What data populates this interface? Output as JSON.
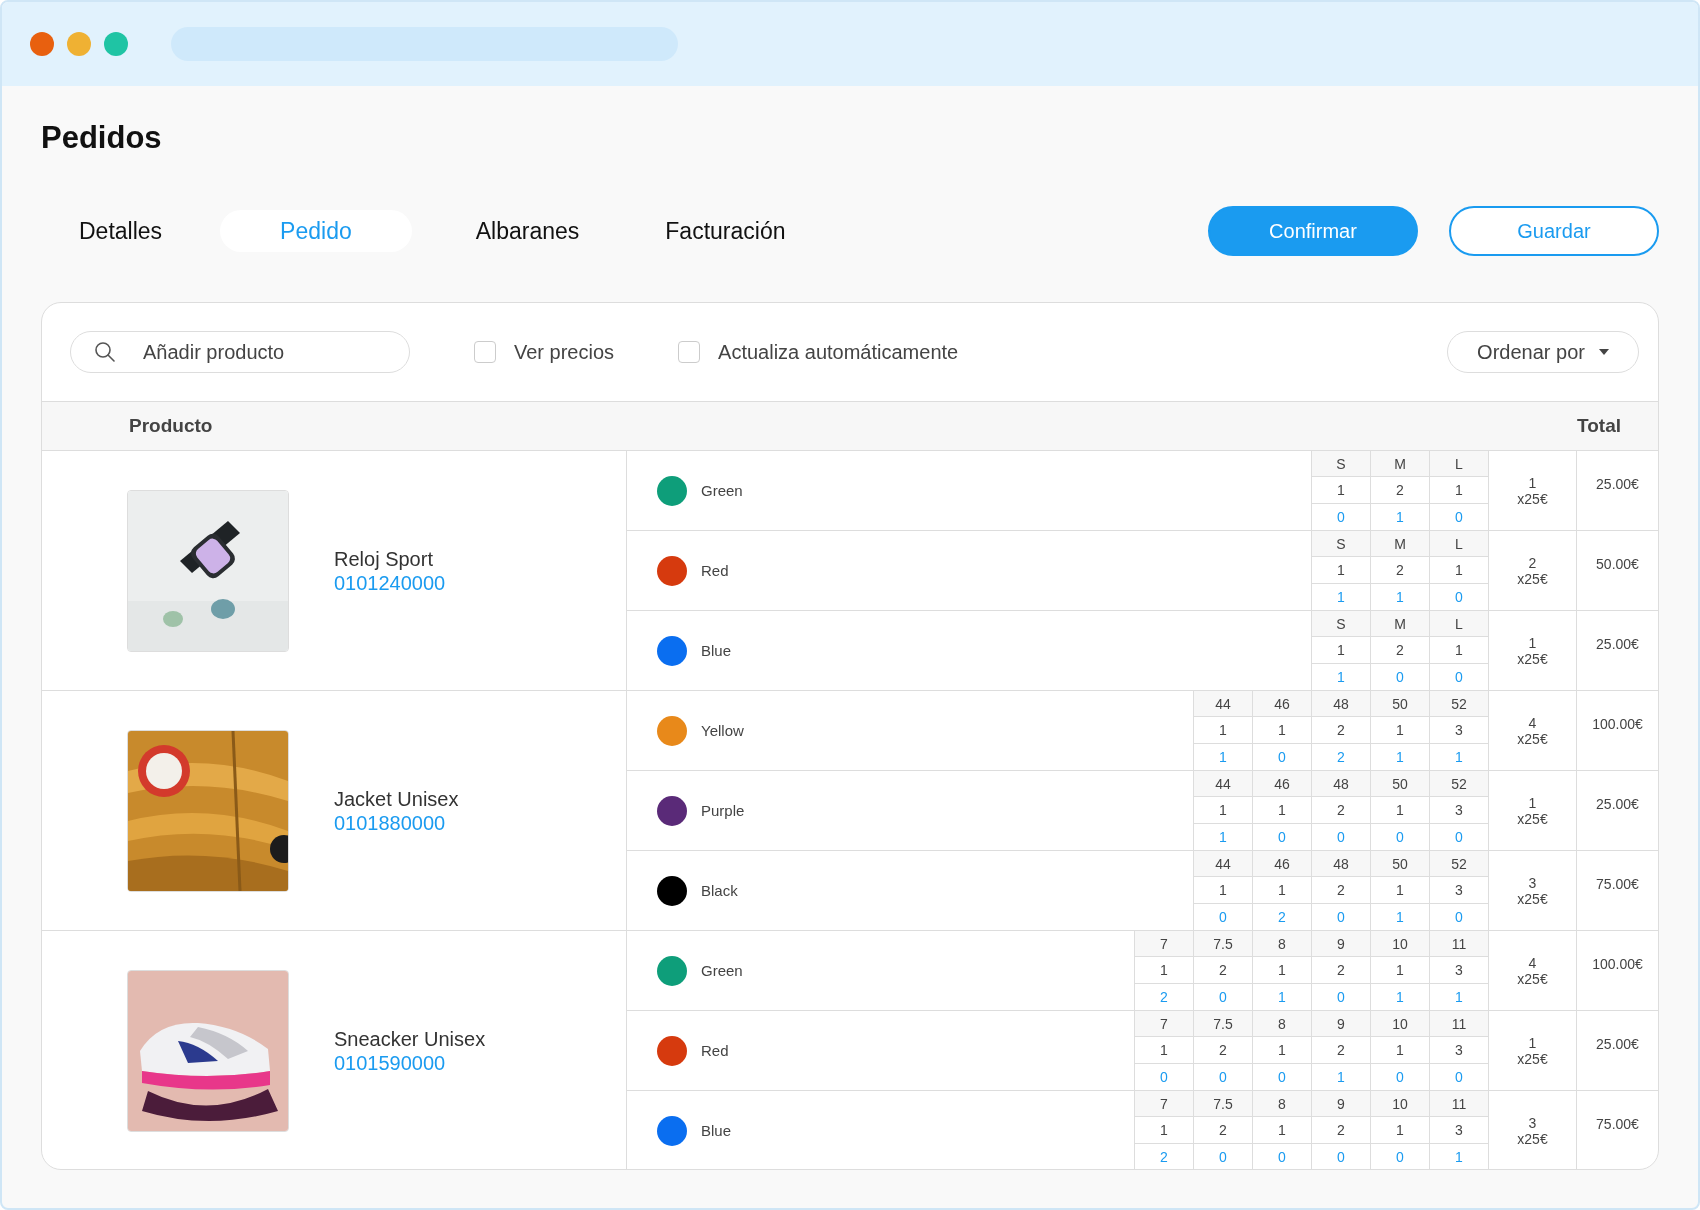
{
  "page_title": "Pedidos",
  "tabs": [
    {
      "label": "Detalles",
      "selected": false
    },
    {
      "label": "Pedido",
      "selected": true
    },
    {
      "label": "Albaranes",
      "selected": false
    },
    {
      "label": "Facturación",
      "selected": false
    }
  ],
  "buttons": [
    {
      "label": "Confirmar",
      "kind": "primary"
    },
    {
      "label": "Guardar",
      "kind": "outline"
    }
  ],
  "toolbar": {
    "search": {
      "placeholder": "Añadir producto"
    },
    "checkboxes": [
      {
        "label": "Ver precios",
        "checked": false
      },
      {
        "label": "Actualiza automáticamente",
        "checked": false
      }
    ],
    "sort": {
      "label": "Ordenar por"
    }
  },
  "table": {
    "columns": [
      "Producto",
      "Total"
    ],
    "products": [
      {
        "name": "Reloj Sport",
        "code": "0101240000",
        "picture": {
          "kind": "picture"
        },
        "variants": [
          {
            "color_name": "Green",
            "color": "#0e9e7a",
            "sizes": [
              "S",
              "M",
              "L"
            ],
            "ordered": [
              "1",
              "2",
              "1"
            ],
            "pending": [
              "0",
              "1",
              "0"
            ],
            "quantity": "1",
            "unit_price": "x25€",
            "total": "25.00€"
          },
          {
            "color_name": "Red",
            "color": "#d63a0e",
            "sizes": [
              "S",
              "M",
              "L"
            ],
            "ordered": [
              "1",
              "2",
              "1"
            ],
            "pending": [
              "1",
              "1",
              "0"
            ],
            "quantity": "2",
            "unit_price": "x25€",
            "total": "50.00€"
          },
          {
            "color_name": "Blue",
            "color": "#0a6ef0",
            "sizes": [
              "S",
              "M",
              "L"
            ],
            "ordered": [
              "1",
              "2",
              "1"
            ],
            "pending": [
              "1",
              "0",
              "0"
            ],
            "quantity": "1",
            "unit_price": "x25€",
            "total": "25.00€"
          }
        ]
      },
      {
        "name": "Jacket Unisex",
        "code": "0101880000",
        "picture": {
          "kind": "picture"
        },
        "variants": [
          {
            "color_name": "Yellow",
            "color": "#e8891a",
            "sizes": [
              "44",
              "46",
              "48",
              "50",
              "52"
            ],
            "ordered": [
              "1",
              "1",
              "2",
              "1",
              "3"
            ],
            "pending": [
              "1",
              "0",
              "2",
              "1",
              "1"
            ],
            "quantity": "4",
            "unit_price": "x25€",
            "total": "100.00€"
          },
          {
            "color_name": "Purple",
            "color": "#5a2a78",
            "sizes": [
              "44",
              "46",
              "48",
              "50",
              "52"
            ],
            "ordered": [
              "1",
              "1",
              "2",
              "1",
              "3"
            ],
            "pending": [
              "1",
              "0",
              "0",
              "0",
              "0"
            ],
            "quantity": "1",
            "unit_price": "x25€",
            "total": "25.00€"
          },
          {
            "color_name": "Black",
            "color": "#000000",
            "sizes": [
              "44",
              "46",
              "48",
              "50",
              "52"
            ],
            "ordered": [
              "1",
              "1",
              "2",
              "1",
              "3"
            ],
            "pending": [
              "0",
              "2",
              "0",
              "1",
              "0"
            ],
            "quantity": "3",
            "unit_price": "x25€",
            "total": "75.00€"
          }
        ]
      },
      {
        "name": "Sneacker Unisex",
        "code": "0101590000",
        "picture": {
          "kind": "picture"
        },
        "variants": [
          {
            "color_name": "Green",
            "color": "#0e9e7a",
            "sizes": [
              "7",
              "7.5",
              "8",
              "9",
              "10",
              "11"
            ],
            "ordered": [
              "1",
              "2",
              "1",
              "2",
              "1",
              "3"
            ],
            "pending": [
              "2",
              "0",
              "1",
              "0",
              "1",
              "1"
            ],
            "quantity": "4",
            "unit_price": "x25€",
            "total": "100.00€"
          },
          {
            "color_name": "Red",
            "color": "#d63a0e",
            "sizes": [
              "7",
              "7.5",
              "8",
              "9",
              "10",
              "11"
            ],
            "ordered": [
              "1",
              "2",
              "1",
              "2",
              "1",
              "3"
            ],
            "pending": [
              "0",
              "0",
              "0",
              "1",
              "0",
              "0"
            ],
            "quantity": "1",
            "unit_price": "x25€",
            "total": "25.00€"
          },
          {
            "color_name": "Blue",
            "color": "#0a6ef0",
            "sizes": [
              "7",
              "7.5",
              "8",
              "9",
              "10",
              "11"
            ],
            "ordered": [
              "1",
              "2",
              "1",
              "2",
              "1",
              "3"
            ],
            "pending": [
              "2",
              "0",
              "0",
              "0",
              "0",
              "1"
            ],
            "quantity": "3",
            "unit_price": "x25€",
            "total": "75.00€"
          }
        ]
      }
    ]
  }
}
